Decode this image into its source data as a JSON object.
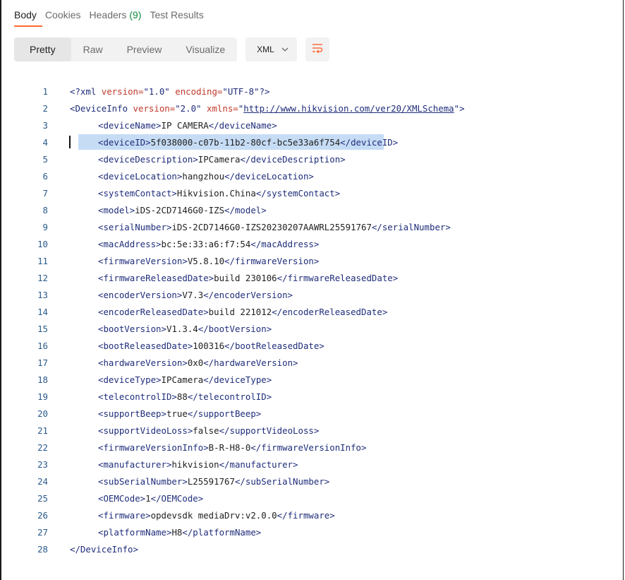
{
  "tabs": {
    "body": "Body",
    "cookies": "Cookies",
    "headers_label": "Headers",
    "headers_count": "(9)",
    "test_results": "Test Results"
  },
  "toolbar": {
    "pretty": "Pretty",
    "raw": "Raw",
    "preview": "Preview",
    "visualize": "Visualize",
    "format": "XML",
    "wrap_icon": "wrap-lines-icon"
  },
  "colors": {
    "accent": "#ff6c37",
    "tag": "#1f2d7a",
    "attribute": "#c0392b",
    "line_number": "#2a5a8a",
    "selection": "#c6dcf5"
  },
  "code": {
    "line1": {
      "num": "1",
      "open": "<?xml ",
      "a1": "version=",
      "v1": "\"1.0\"",
      "sp": " ",
      "a2": "encoding=",
      "v2": "\"UTF-8\"",
      "close": "?>"
    },
    "line2": {
      "num": "2",
      "open": "<DeviceInfo ",
      "a1": "version=",
      "v1": "\"2.0\"",
      "sp": " ",
      "a2": "xmlns=",
      "q": "\"",
      "url": "http://www.hikvision.com/ver20/XMLSchema",
      "q2": "\"",
      "close": ">"
    },
    "elements": [
      {
        "num": "3",
        "name": "deviceName",
        "value": "IP CAMERA"
      },
      {
        "num": "4",
        "name": "deviceID",
        "value": "5f038000-c07b-11b2-80cf-bc5e33a6f754"
      },
      {
        "num": "5",
        "name": "deviceDescription",
        "value": "IPCamera"
      },
      {
        "num": "6",
        "name": "deviceLocation",
        "value": "hangzhou"
      },
      {
        "num": "7",
        "name": "systemContact",
        "value": "Hikvision.China"
      },
      {
        "num": "8",
        "name": "model",
        "value": "iDS-2CD7146G0-IZS"
      },
      {
        "num": "9",
        "name": "serialNumber",
        "value": "iDS-2CD7146G0-IZS20230207AAWRL25591767"
      },
      {
        "num": "10",
        "name": "macAddress",
        "value": "bc:5e:33:a6:f7:54"
      },
      {
        "num": "11",
        "name": "firmwareVersion",
        "value": "V5.8.10"
      },
      {
        "num": "12",
        "name": "firmwareReleasedDate",
        "value": "build 230106"
      },
      {
        "num": "13",
        "name": "encoderVersion",
        "value": "V7.3"
      },
      {
        "num": "14",
        "name": "encoderReleasedDate",
        "value": "build 221012"
      },
      {
        "num": "15",
        "name": "bootVersion",
        "value": "V1.3.4"
      },
      {
        "num": "16",
        "name": "bootReleasedDate",
        "value": "100316"
      },
      {
        "num": "17",
        "name": "hardwareVersion",
        "value": "0x0"
      },
      {
        "num": "18",
        "name": "deviceType",
        "value": "IPCamera"
      },
      {
        "num": "19",
        "name": "telecontrolID",
        "value": "88"
      },
      {
        "num": "20",
        "name": "supportBeep",
        "value": "true"
      },
      {
        "num": "21",
        "name": "supportVideoLoss",
        "value": "false"
      },
      {
        "num": "22",
        "name": "firmwareVersionInfo",
        "value": "B-R-H8-0"
      },
      {
        "num": "23",
        "name": "manufacturer",
        "value": "hikvision"
      },
      {
        "num": "24",
        "name": "subSerialNumber",
        "value": "L25591767"
      },
      {
        "num": "25",
        "name": "OEMCode",
        "value": "1"
      },
      {
        "num": "26",
        "name": "firmware",
        "value": "opdevsdk mediaDrv:v2.0.0"
      },
      {
        "num": "27",
        "name": "platformName",
        "value": "H8"
      }
    ],
    "last": {
      "num": "28",
      "text": "</DeviceInfo>"
    }
  }
}
